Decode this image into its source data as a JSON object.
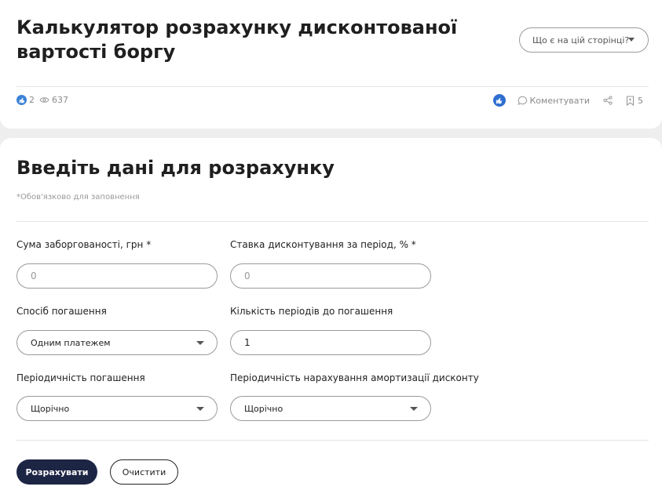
{
  "header": {
    "title": "Калькулятор розрахунку дисконтованої вартості боргу",
    "help_dropdown": "Що є на цій сторінці?"
  },
  "stats": {
    "likes": "2",
    "views": "637"
  },
  "actions": {
    "comment_label": "Коментувати",
    "bookmarks_count": "5"
  },
  "form": {
    "title": "Введіть дані для розрахунку",
    "required_note": "*Обов'язково для заповнення",
    "fields": {
      "debt_amount": {
        "label": "Сума заборгованості, грн *",
        "placeholder": "0"
      },
      "discount_rate": {
        "label": "Ставка дисконтування за період, % *",
        "placeholder": "0"
      },
      "repayment_method": {
        "label": "Спосіб погашення",
        "value": "Одним платежем"
      },
      "periods_count": {
        "label": "Кількість періодів до погашення",
        "value": "1"
      },
      "repayment_frequency": {
        "label": "Періодичність погашення",
        "value": "Щорічно"
      },
      "amortization_frequency": {
        "label": "Періодичність нарахування амортизації дисконту",
        "value": "Щорічно"
      }
    },
    "buttons": {
      "calculate": "Розрахувати",
      "clear": "Очистити"
    }
  },
  "colors": {
    "primary_button": "#1d2545",
    "like_accent": "#2f6fd0"
  }
}
